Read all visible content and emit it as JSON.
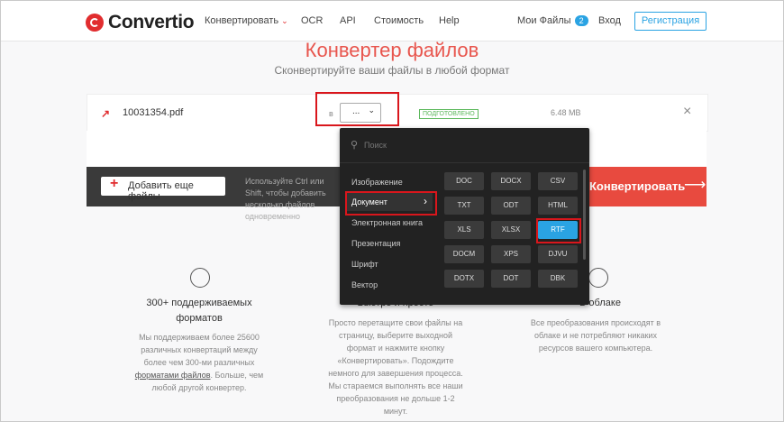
{
  "header": {
    "logo_text": "Convertio",
    "nav": {
      "convert": "Конвертировать",
      "ocr": "OCR",
      "api": "API",
      "pricing": "Стоимость",
      "help": "Help",
      "my_files": "Мои Файлы",
      "my_files_count": "2",
      "login": "Вход",
      "register": "Регистрация"
    }
  },
  "hero": {
    "title": "Конвертер файлов",
    "subtitle": "Сконвертируйте ваши файлы в любой формат"
  },
  "file": {
    "name": "10031354.pdf",
    "in_label": "в",
    "format_value": "...",
    "status": "ПОДГОТОВЛЕНО",
    "size": "6.48 MB"
  },
  "actions": {
    "add_files": "Добавить еще файлы",
    "hint": "Используйте Ctrl или Shift, чтобы добавить несколько файлов одновременно",
    "convert": "Конвертировать"
  },
  "dropdown": {
    "search_placeholder": "Поиск",
    "categories": [
      "Изображение",
      "Документ",
      "Электронная книга",
      "Презентация",
      "Шрифт",
      "Вектор"
    ],
    "active_category": "Документ",
    "formats": [
      "DOC",
      "DOCX",
      "CSV",
      "TXT",
      "ODT",
      "HTML",
      "XLS",
      "XLSX",
      "RTF",
      "DOCM",
      "XPS",
      "DJVU",
      "DOTX",
      "DOT",
      "DBK"
    ],
    "selected_format": "RTF"
  },
  "features": {
    "f1": {
      "title": "300+ поддерживаемых форматов",
      "text_before_link": "Мы поддерживаем более 25600 различных конвертаций между более чем 300-ми различных",
      "link": "форматами файлов",
      "text_after_link": ". Больше, чем любой другой конвертер."
    },
    "f2": {
      "title": "Быстро и просто",
      "text": "Просто перетащите свои файлы на страницу, выберите выходной формат и нажмите кнопку «Конвертировать». Подождите немного для завершения процесса. Мы стараемся выполнять все наши преобразования не дольше 1-2 минут."
    },
    "f3": {
      "title": "В облаке",
      "text": "Все преобразования происходят в облаке и не потребляют никаких ресурсов вашего компьютера."
    }
  },
  "colors": {
    "brand_red": "#e12d2f",
    "accent_blue": "#2aa3e3",
    "convert_red": "#e84a3f",
    "highlight_box": "#d9161c"
  }
}
